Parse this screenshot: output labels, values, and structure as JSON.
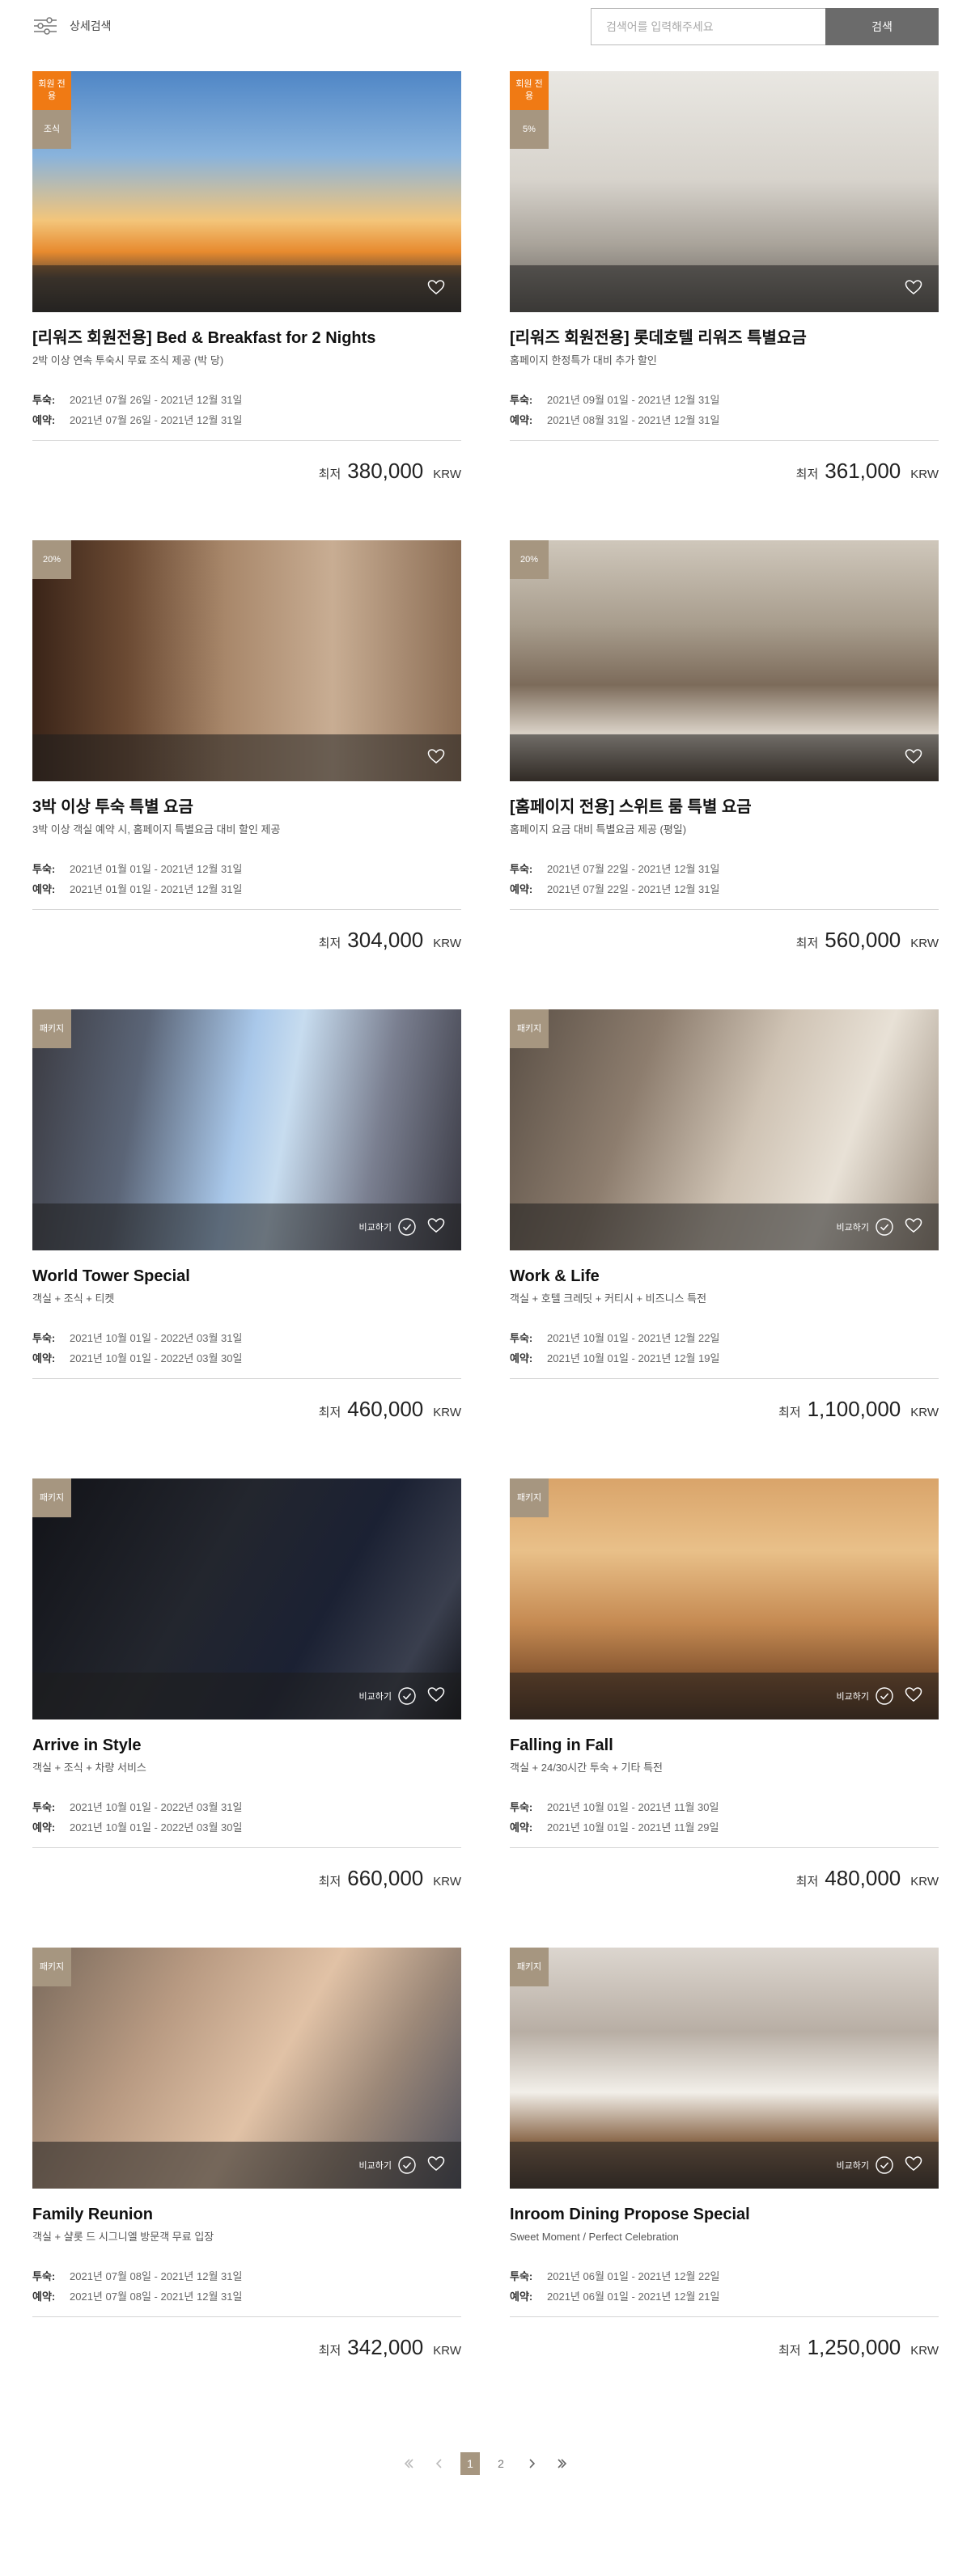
{
  "topbar": {
    "filter_label": "상세검색",
    "search_placeholder": "검색어를 입력해주세요",
    "search_button": "검색"
  },
  "labels": {
    "stay": "투숙:",
    "reserve": "예약:",
    "price_prefix": "최저",
    "currency": "KRW",
    "compare": "비교하기"
  },
  "colors": {
    "member_tag": "#f07a14",
    "tag": "#a69680",
    "search_button": "#6b6b6b"
  },
  "offers": [
    {
      "tags": [
        {
          "text": "회원 전용",
          "style": "orange"
        },
        {
          "text": "조식",
          "style": "gray"
        }
      ],
      "image": "lotte-world-tower-sunset",
      "title": "[리워즈 회원전용] Bed & Breakfast for 2 Nights",
      "desc": "2박 이상 연속 투숙시 무료 조식 제공 (박 당)",
      "stay": "2021년 07월 26일 - 2021년 12월 31일",
      "reserve": "2021년 07월 26일 - 2021년 12월 31일",
      "price": "380,000",
      "compare": false
    },
    {
      "tags": [
        {
          "text": "회원 전용",
          "style": "orange"
        },
        {
          "text": "5%",
          "style": "gray"
        }
      ],
      "image": "hotel-entrance",
      "title": "[리워즈 회원전용] 롯데호텔 리워즈 특별요금",
      "desc": "홈페이지 한정특가 대비 추가 할인",
      "stay": "2021년 09월 01일 - 2021년 12월 31일",
      "reserve": "2021년 08월 31일 - 2021년 12월 31일",
      "price": "361,000",
      "compare": false
    },
    {
      "tags": [
        {
          "text": "20%",
          "style": "gray"
        }
      ],
      "image": "door-handle",
      "title": "3박 이상 투숙 특별 요금",
      "desc": "3박 이상 객실 예약 시, 홈페이지 특별요금 대비 할인 제공",
      "stay": "2021년 01월 01일 - 2021년 12월 31일",
      "reserve": "2021년 01월 01일 - 2021년 12월 31일",
      "price": "304,000",
      "compare": false
    },
    {
      "tags": [
        {
          "text": "20%",
          "style": "gray"
        }
      ],
      "image": "suite-room",
      "title": "[홈페이지 전용] 스위트 룸 특별 요금",
      "desc": "홈페이지 요금 대비 특별요금 제공 (평일)",
      "stay": "2021년 07월 22일 - 2021년 12월 31일",
      "reserve": "2021년 07월 22일 - 2021년 12월 31일",
      "price": "560,000",
      "compare": false
    },
    {
      "tags": [
        {
          "text": "패키지",
          "style": "gray"
        }
      ],
      "image": "tower-looking-up",
      "title": "World Tower Special",
      "desc": "객실 + 조식 + 티켓",
      "stay": "2021년 10월 01일 - 2022년 03월 31일",
      "reserve": "2021년 10월 01일 - 2022년 03월 30일",
      "price": "460,000",
      "compare": true
    },
    {
      "tags": [
        {
          "text": "패키지",
          "style": "gray"
        }
      ],
      "image": "woman-laptop-bed",
      "title": "Work & Life",
      "desc": "객실 + 호텔 크레딧 + 커티시 + 비즈니스 특전",
      "stay": "2021년 10월 01일 - 2021년 12월 22일",
      "reserve": "2021년 10월 01일 - 2021년 12월 19일",
      "price": "1,100,000",
      "compare": true
    },
    {
      "tags": [
        {
          "text": "패키지",
          "style": "gray"
        }
      ],
      "image": "chauffeur-car-door",
      "title": "Arrive in Style",
      "desc": "객실 + 조식 + 차량 서비스",
      "stay": "2021년 10월 01일 - 2022년 03월 31일",
      "reserve": "2021년 10월 01일 - 2022년 03월 30일",
      "price": "660,000",
      "compare": true
    },
    {
      "tags": [
        {
          "text": "패키지",
          "style": "gray"
        }
      ],
      "image": "autumn-grass",
      "title": "Falling in Fall",
      "desc": "객실 + 24/30시간 투숙 + 기타 특전",
      "stay": "2021년 10월 01일 - 2021년 11월 30일",
      "reserve": "2021년 10월 01일 - 2021년 11월 29일",
      "price": "480,000",
      "compare": true
    },
    {
      "tags": [
        {
          "text": "패키지",
          "style": "gray"
        }
      ],
      "image": "holding-hands",
      "title": "Family Reunion",
      "desc": "객실 + 샬롯 드 시그니엘 방문객 무료 입장",
      "stay": "2021년 07월 08일 - 2021년 12월 31일",
      "reserve": "2021년 07월 08일 - 2021년 12월 31일",
      "price": "342,000",
      "compare": true
    },
    {
      "tags": [
        {
          "text": "패키지",
          "style": "gray"
        }
      ],
      "image": "inroom-dining",
      "title": "Inroom Dining Propose Special",
      "desc": "Sweet Moment / Perfect Celebration",
      "stay": "2021년 06월 01일 - 2021년 12월 22일",
      "reserve": "2021년 06월 01일 - 2021년 12월 21일",
      "price": "1,250,000",
      "compare": true
    }
  ],
  "pagination": {
    "pages": [
      "1",
      "2"
    ],
    "current": "1"
  }
}
